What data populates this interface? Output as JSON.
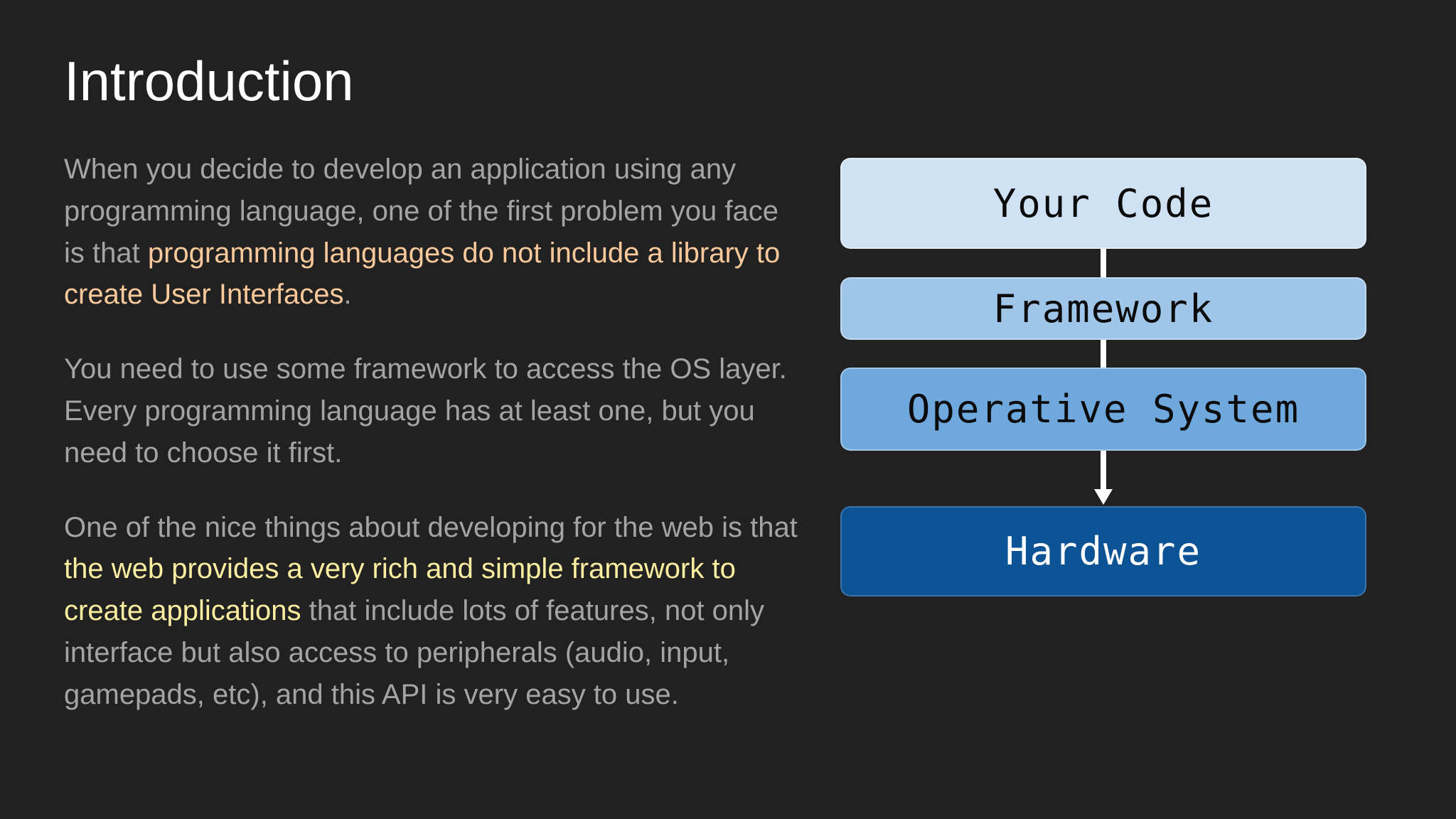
{
  "slide": {
    "title": "Introduction"
  },
  "paragraphs": {
    "p1": {
      "text_1": "When you decide to develop an application using any programming language, one of the first problem you face is that ",
      "highlight": "programming languages do not include a library to create User Interfaces",
      "text_2": "."
    },
    "p2": {
      "text": "You need to use some framework to access the OS layer. Every programming language has at least one, but you need to choose it first."
    },
    "p3": {
      "text_1": "One of the nice things about developing for the web is that ",
      "highlight": "the web provides a very rich and simple framework to create applications",
      "text_2": " that include lots of features, not only interface but also access to peripherals (audio, input, gamepads, etc), and this API is very easy to use."
    }
  },
  "diagram": {
    "layers": [
      {
        "label": "Your Code",
        "color": "#cfe2f3"
      },
      {
        "label": "Framework",
        "color": "#9fc5e8"
      },
      {
        "label": "Operative System",
        "color": "#6fa8dc"
      },
      {
        "label": "Hardware",
        "color": "#0b5394"
      }
    ]
  },
  "colors": {
    "background": "#212121",
    "body_text": "#a4a4a4",
    "highlight_orange": "#f9c99c",
    "highlight_yellow": "#fbeea0"
  }
}
